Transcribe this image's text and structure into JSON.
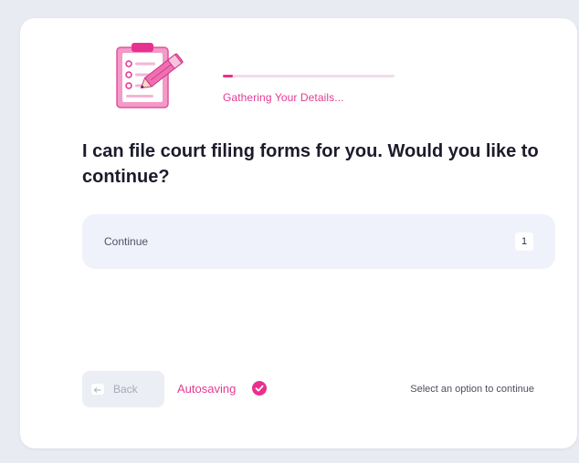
{
  "progress": {
    "label": "Gathering Your Details...",
    "value_percent": 6
  },
  "question": {
    "text": "I can file court filing forms for you. Would you like to continue?"
  },
  "options": [
    {
      "label": "Continue",
      "key": "1"
    }
  ],
  "footer": {
    "back_label": "Back",
    "autosave_label": "Autosaving",
    "hint": "Select an option to continue"
  },
  "icons": {
    "header": "clipboard-pencil-icon",
    "back": "back-arrow-icon",
    "autosave": "check-circle-icon"
  },
  "colors": {
    "accent": "#e8308f",
    "option_bg": "#eff1fb",
    "background": "#e9ebf3"
  }
}
